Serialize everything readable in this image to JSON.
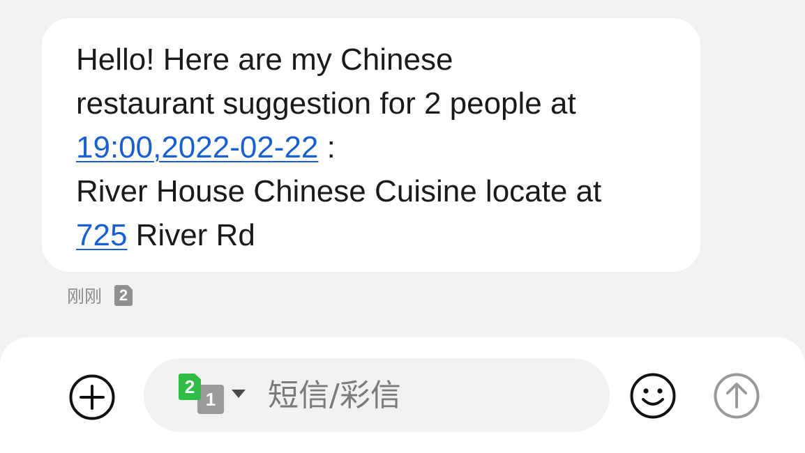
{
  "message": {
    "line1": "Hello! Here are my Chinese",
    "line2": "restaurant suggestion for 2 people at",
    "datetime_link": "19:00,2022-02-22",
    "line3_suffix": " :",
    "line4": "River House Chinese Cuisine locate at",
    "address_number_link": "725",
    "line5_suffix": " River Rd",
    "link_color": "#1a5fce"
  },
  "meta": {
    "time": "刚刚",
    "sim_badge": "2"
  },
  "composer": {
    "sim_front": "2",
    "sim_back": "1",
    "placeholder": "短信/彩信",
    "sim_front_color": "#2fbd45"
  },
  "icons": {
    "add": "add-circle-icon",
    "sim_switch": "sim-switch-icon",
    "caret": "caret-down-icon",
    "emoji": "smiley-icon",
    "send": "send-arrow-up-icon"
  }
}
